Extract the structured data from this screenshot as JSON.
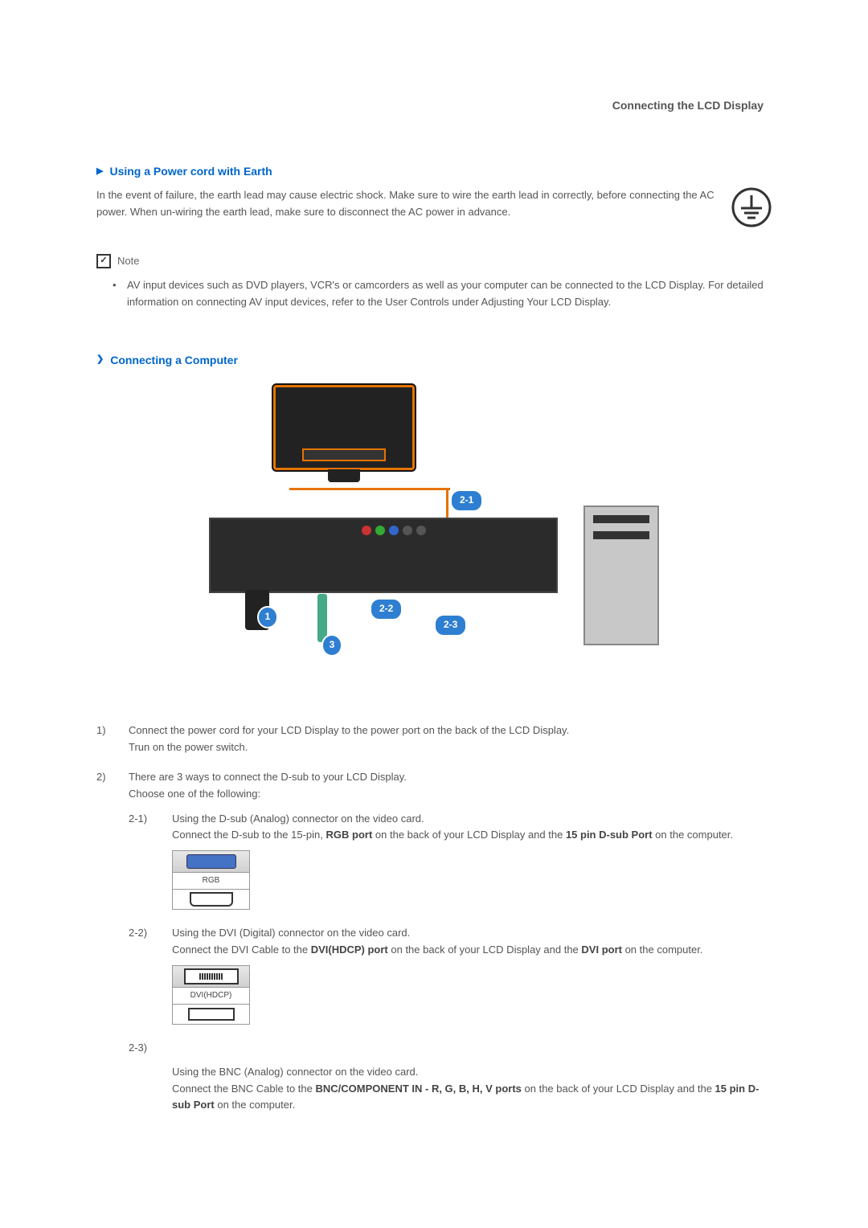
{
  "header": {
    "title": "Connecting the LCD Display"
  },
  "section1": {
    "heading": "Using a Power cord with Earth",
    "body": "In the event of failure, the earth lead may cause electric shock. Make sure to wire the earth lead in correctly, before connecting the AC power. When un-wiring the earth lead, make sure to disconnect the AC power in advance."
  },
  "note": {
    "label": "Note",
    "bullet": "AV input devices such as DVD players, VCR's or camcorders as well as your computer can be connected to the LCD Display. For detailed information on connecting AV input devices, refer to the User Controls under Adjusting Your LCD Display."
  },
  "section2": {
    "heading": "Connecting a Computer"
  },
  "diagram": {
    "lbl_21": "2-1",
    "lbl_22": "2-2",
    "lbl_23": "2-3",
    "lbl_1": "1",
    "lbl_3": "3"
  },
  "steps": {
    "s1": {
      "num": "1)",
      "text_a": "Connect the power cord for your LCD Display to the power port on the back of the LCD Display.",
      "text_b": "Trun on the power switch."
    },
    "s2": {
      "num": "2)",
      "intro_a": "There are 3 ways to connect the D-sub to your LCD Display.",
      "intro_b": "Choose one of the following:",
      "s21": {
        "num": "2-1)",
        "line1": "Using the D-sub (Analog) connector on the video card.",
        "line2_a": "Connect the D-sub to the 15-pin, ",
        "line2_b": "RGB port",
        "line2_c": " on the back of your LCD Display and the ",
        "line2_d": "15 pin D-sub Port",
        "line2_e": " on the computer.",
        "port_label": "RGB"
      },
      "s22": {
        "num": "2-2)",
        "line1": "Using the DVI (Digital) connector on the video card.",
        "line2_a": "Connect the DVI Cable to the ",
        "line2_b": "DVI(HDCP) port",
        "line2_c": " on the back of your LCD Display and the ",
        "line2_d": "DVI port",
        "line2_e": " on the computer.",
        "port_label": "DVI(HDCP)"
      },
      "s23": {
        "num": "2-3)",
        "line1": "Using the BNC (Analog) connector on the video card.",
        "line2_a": "Connect the BNC Cable to the ",
        "line2_b": "BNC/COMPONENT IN - R, G, B, H, V ports",
        "line2_c": " on the back of your LCD Display and the ",
        "line2_d": "15 pin D-sub Port",
        "line2_e": " on the computer."
      }
    }
  }
}
